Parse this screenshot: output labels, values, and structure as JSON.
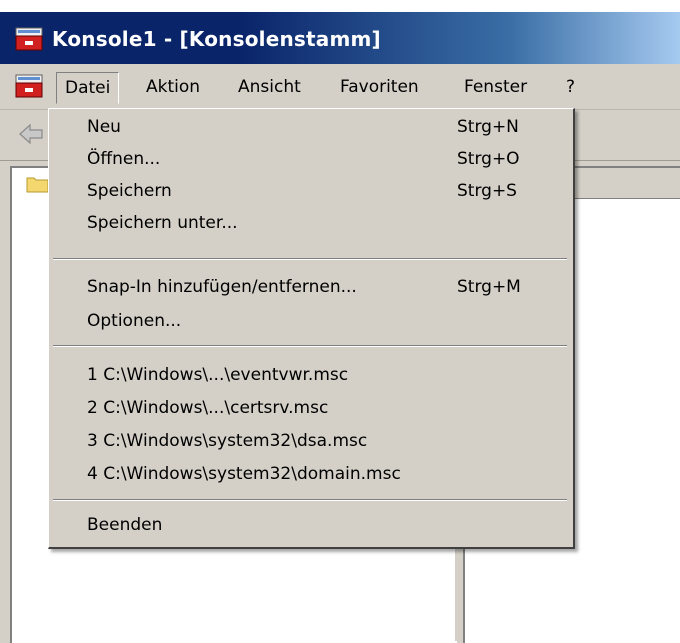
{
  "window": {
    "title": "Konsole1 - [Konsolenstamm]"
  },
  "menubar": {
    "items": [
      {
        "label": "Datei",
        "open": true
      },
      {
        "label": "Aktion"
      },
      {
        "label": "Ansicht"
      },
      {
        "label": "Favoriten"
      },
      {
        "label": "Fenster"
      },
      {
        "label": "?"
      }
    ]
  },
  "toolbar": {
    "back_icon": "back-arrow-icon"
  },
  "file_menu": {
    "items": [
      {
        "label": "Neu",
        "shortcut": "Strg+N"
      },
      {
        "label": "Öffnen...",
        "shortcut": "Strg+O"
      },
      {
        "label": "Speichern",
        "shortcut": "Strg+S"
      },
      {
        "label": "Speichern unter...",
        "shortcut": ""
      },
      {
        "label": "Snap-In hinzufügen/entfernen...",
        "shortcut": "Strg+M"
      },
      {
        "label": "Optionen...",
        "shortcut": ""
      },
      {
        "label": "1 C:\\Windows\\...\\eventvwr.msc",
        "shortcut": ""
      },
      {
        "label": "2 C:\\Windows\\...\\certsrv.msc",
        "shortcut": ""
      },
      {
        "label": "3 C:\\Windows\\system32\\dsa.msc",
        "shortcut": ""
      },
      {
        "label": "4 C:\\Windows\\system32\\domain.msc",
        "shortcut": ""
      },
      {
        "label": "Beenden",
        "shortcut": ""
      }
    ]
  },
  "colors": {
    "title_bar": "#0a246a",
    "face": "#d4d0c8",
    "pane": "#ffffff"
  }
}
